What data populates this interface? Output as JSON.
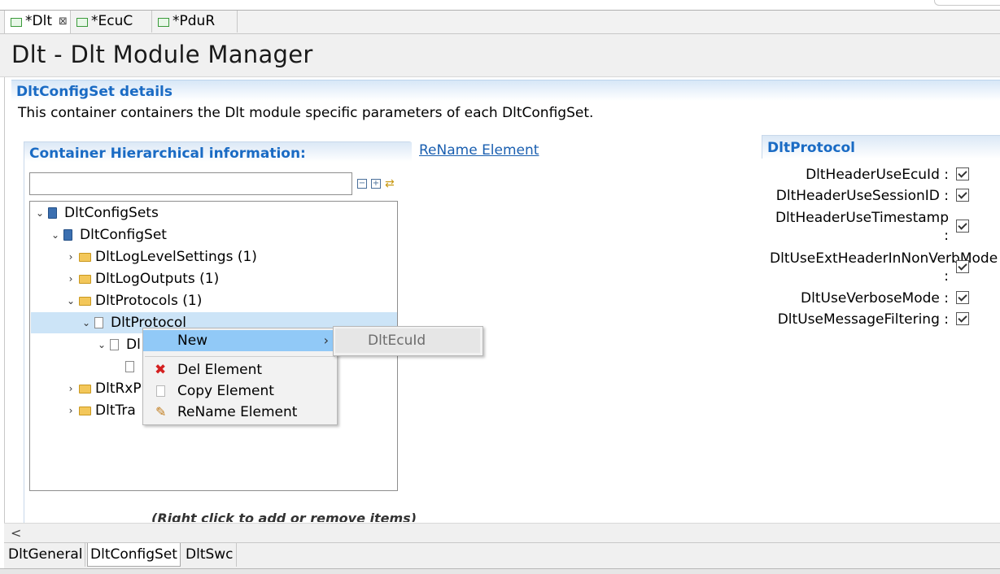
{
  "editor_tabs": [
    {
      "label": "*Dlt",
      "close": "⊠"
    },
    {
      "label": "*EcuC"
    },
    {
      "label": "*PduR"
    }
  ],
  "page_title": "Dlt - Dlt Module Manager",
  "section": {
    "title": "DltConfigSet details",
    "description": "This container containers the Dlt module specific parameters of each DltConfigSet."
  },
  "hierarchy": {
    "title": "Container Hierarchical information:",
    "filter_value": "",
    "rename_link": "ReName Element",
    "helper_text": "(Right click to add or remove items)",
    "tree": [
      {
        "label": "DltConfigSets",
        "twisty": "⌄",
        "icon": "book-icon"
      },
      {
        "label": "DltConfigSet",
        "twisty": "⌄",
        "icon": "book-icon"
      },
      {
        "label": "DltLogLevelSettings (1)",
        "twisty": "›",
        "icon": "folder-icon"
      },
      {
        "label": "DltLogOutputs (1)",
        "twisty": "›",
        "icon": "folder-icon"
      },
      {
        "label": "DltProtocols (1)",
        "twisty": "⌄",
        "icon": "folder-icon"
      },
      {
        "label": "DltProtocol",
        "twisty": "⌄",
        "icon": "document-icon"
      },
      {
        "label": "Dl",
        "twisty": "⌄",
        "icon": "document-icon"
      },
      {
        "label": "",
        "twisty": "",
        "icon": "document-icon"
      },
      {
        "label": "DltRxP",
        "twisty": "›",
        "icon": "folder-icon"
      },
      {
        "label": "DltTra",
        "twisty": "›",
        "icon": "folder-icon"
      }
    ]
  },
  "context_menu": {
    "items": [
      {
        "label": "New",
        "icon": "",
        "chevron": "›"
      },
      {
        "label": "Del Element",
        "icon": "delete-icon"
      },
      {
        "label": "Copy Element",
        "icon": "copy-icon"
      },
      {
        "label": "ReName Element",
        "icon": "pencil-icon"
      }
    ],
    "submenu": {
      "label": "DltEcuId"
    }
  },
  "properties": {
    "title": "DltProtocol",
    "fields": [
      {
        "label": "DltHeaderUseEcuId :",
        "checked": true
      },
      {
        "label": "DltHeaderUseSessionID :",
        "checked": true
      },
      {
        "label": "DltHeaderUseTimestamp :",
        "checked": true
      },
      {
        "label": "DltUseExtHeaderInNonVerbMode :",
        "checked": true
      },
      {
        "label": "DltUseVerboseMode :",
        "checked": true
      },
      {
        "label": "DltUseMessageFiltering :",
        "checked": true
      }
    ]
  },
  "scroll_left": "<",
  "bottom_tabs": [
    {
      "label": "DltGeneral"
    },
    {
      "label": "DltConfigSet"
    },
    {
      "label": "DltSwc"
    }
  ]
}
